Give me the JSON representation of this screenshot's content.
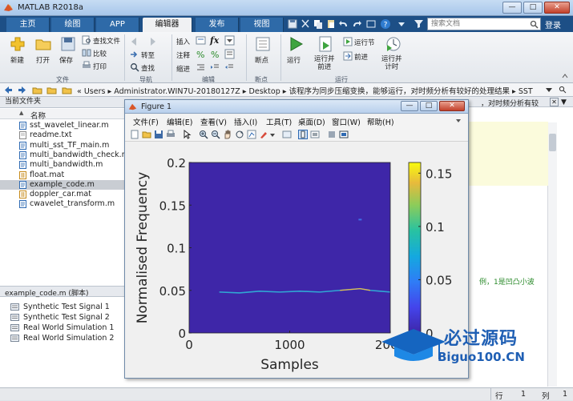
{
  "app": {
    "title": "MATLAB R2018a"
  },
  "tabs": [
    "主页",
    "绘图",
    "APP",
    "编辑器",
    "发布",
    "视图"
  ],
  "active_tab": "编辑器",
  "search": {
    "placeholder": "搜索文档"
  },
  "login_label": "登录",
  "ribbon": {
    "new": "新建",
    "open": "打开",
    "save": "保存",
    "find_files": "查找文件",
    "compare": "比较",
    "print": "打印",
    "goto": "转至",
    "find": "查找",
    "insert": "插入",
    "comment": "注释",
    "indent": "缩进",
    "breakpoints": "断点",
    "run": "运行",
    "run_advance": "运行并\n前进",
    "run_section": "运行节",
    "advance": "前进",
    "run_time": "运行并\n计时",
    "groups": {
      "file": "文件",
      "navigate": "导航",
      "edit": "编辑",
      "breakpoint": "断点",
      "run": "运行"
    },
    "fx": "fx"
  },
  "address": {
    "crumbs": "« Users ▸ Administrator.WIN7U-20180127Z ▸ Desktop ▸ 该程序为同步压缩变换，能够运行，对时频分析有较好的处理结果 ▸ SST"
  },
  "current_folder": {
    "title": "当前文件夹",
    "name_header": "名称",
    "sort_indicator": "▲",
    "files": [
      {
        "name": "sst_wavelet_linear.m",
        "kind": "m"
      },
      {
        "name": "readme.txt",
        "kind": "txt"
      },
      {
        "name": "multi_sst_TF_main.m",
        "kind": "m"
      },
      {
        "name": "multi_bandwidth_check.m",
        "kind": "m"
      },
      {
        "name": "multi_bandwidth.m",
        "kind": "m"
      },
      {
        "name": "float.mat",
        "kind": "mat"
      },
      {
        "name": "example_code.m",
        "kind": "m",
        "selected": true
      },
      {
        "name": "doppler_car.mat",
        "kind": "mat"
      },
      {
        "name": "cwavelet_transform.m",
        "kind": "m"
      }
    ]
  },
  "details": {
    "title": "example_code.m  (脚本)",
    "items": [
      "Synthetic  Test Signal 1",
      "Synthetic  Test Signal 2",
      "Real World Simulation 1",
      "Real World Simulation 2"
    ]
  },
  "background": {
    "header_text": "，对时频分析有较",
    "comment_text": "例，1是凹凸小波"
  },
  "figure": {
    "title": "Figure 1",
    "menus": [
      "文件(F)",
      "编辑(E)",
      "查看(V)",
      "插入(I)",
      "工具(T)",
      "桌面(D)",
      "窗口(W)",
      "帮助(H)"
    ]
  },
  "chart_data": {
    "type": "heatmap",
    "title": "",
    "xlabel": "Samples",
    "ylabel": "Normalised Frequency",
    "xlim": [
      0,
      2000
    ],
    "ylim": [
      0,
      0.2
    ],
    "xticks": [
      0,
      1000,
      2000
    ],
    "yticks": [
      0,
      0.05,
      0.1,
      0.15,
      0.2
    ],
    "colorbar_ticks": [
      0,
      0.05,
      0.1,
      0.15
    ],
    "colorbar_range": [
      0,
      0.16
    ],
    "background_color": "#3e26a8",
    "ridge": {
      "x": [
        300,
        500,
        700,
        900,
        1100,
        1300,
        1500,
        1700,
        1800,
        1900,
        2000
      ],
      "y": [
        0.048,
        0.047,
        0.049,
        0.048,
        0.049,
        0.048,
        0.05,
        0.052,
        0.05,
        0.049,
        0.048
      ]
    },
    "spot": {
      "x": 1700,
      "y": 0.133
    }
  },
  "status_bar": {
    "row_label": "行",
    "row": "1",
    "col_label": "列",
    "col": "1"
  },
  "watermark": {
    "text": "必过源码",
    "url": "Biguo100.CN"
  },
  "colors": {
    "ribbon_tab_bar": "#1d4f86",
    "active_tab": "#f0f1f3",
    "parula_low": "#3e26a8",
    "parula_high": "#f9fb0e"
  }
}
